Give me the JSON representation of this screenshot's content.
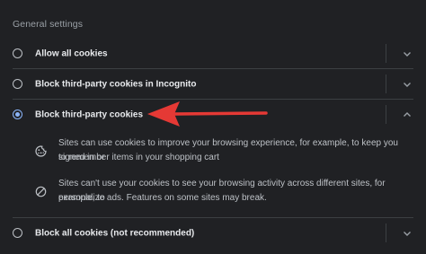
{
  "section": {
    "title": "General settings"
  },
  "options": [
    {
      "label": "Allow all cookies",
      "selected": false,
      "expanded": false
    },
    {
      "label": "Block third-party cookies in Incognito",
      "selected": false,
      "expanded": false
    },
    {
      "label": "Block third-party cookies",
      "selected": true,
      "expanded": true
    },
    {
      "label": "Block all cookies (not recommended)",
      "selected": false,
      "expanded": false
    }
  ],
  "details": [
    {
      "icon": "cookie-icon",
      "line1": "Sites can use cookies to improve your browsing experience, for example, to keep you signed in or",
      "line2": "to remember items in your shopping cart"
    },
    {
      "icon": "block-icon",
      "line1": "Sites can't use your cookies to see your browsing activity across different sites, for example, to",
      "line2": "personalize ads. Features on some sites may break."
    }
  ],
  "colors": {
    "background": "#202124",
    "accent": "#8ab4f8",
    "annotation_arrow": "#e53935"
  }
}
